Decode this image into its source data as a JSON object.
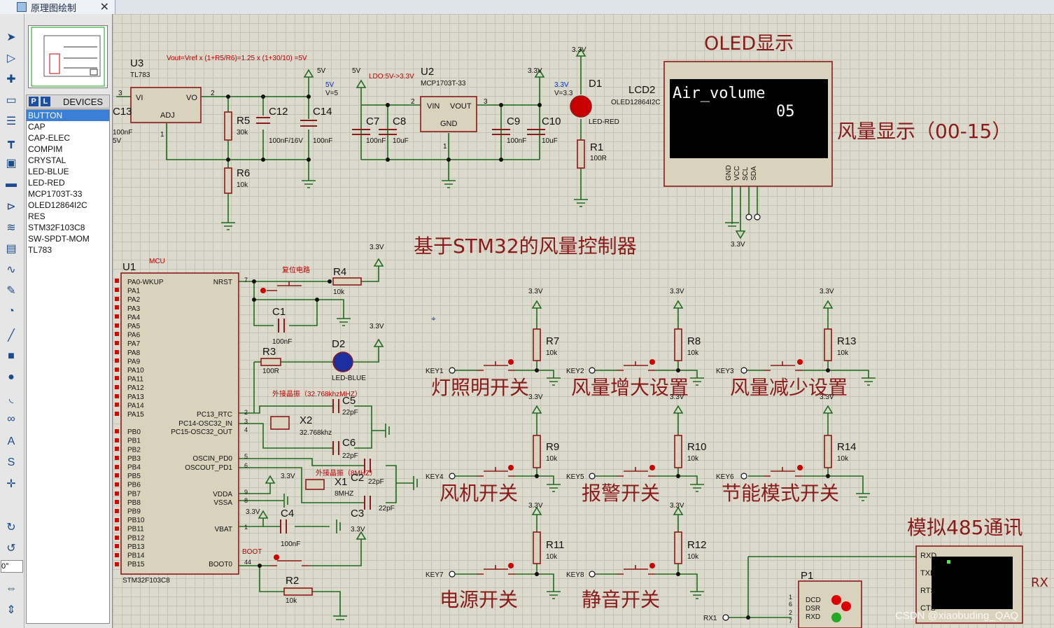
{
  "tab": {
    "title": "原理图绘制",
    "close": "✕"
  },
  "panel": {
    "p": "P",
    "l": "L",
    "header": "DEVICES",
    "rotation": "0°"
  },
  "devices": [
    "BUTTON",
    "CAP",
    "CAP-ELEC",
    "COMPIM",
    "CRYSTAL",
    "LED-BLUE",
    "LED-RED",
    "MCP1703T-33",
    "OLED12864I2C",
    "RES",
    "STM32F103C8",
    "SW-SPDT-MOM",
    "TL783"
  ],
  "title": "基于STM32的风量控制器",
  "oled": {
    "title": "OLED显示",
    "line1": "Air_volume",
    "line2": "05",
    "ref": "LCD2",
    "part": "OLED12864I2C",
    "caption": "风量显示（00-15）",
    "pins": [
      "GND",
      "VCC",
      "SCL",
      "SDA"
    ],
    "pinnums": [
      "1",
      "2",
      "3",
      "4"
    ],
    "v": "3.3V"
  },
  "u3": {
    "ref": "U3",
    "part": "TL783",
    "formula": "Vout=Vref x (1+R5/R6)=1.25 x (1+30/10) =5V",
    "vi": "VI",
    "vo": "VO",
    "adj": "ADJ",
    "p3": "3",
    "p2": "2",
    "p1": "1",
    "out": "5V",
    "probe": "5V",
    "probev": "V=5"
  },
  "u3parts": {
    "c13": "C13",
    "c13v": "100nF",
    "c13v2": "5V",
    "r5": "R5",
    "r5v": "30k",
    "r6": "R6",
    "r6v": "10k",
    "c12": "C12",
    "c12v": "100nF/16V",
    "c14": "C14",
    "c14v": "100nF"
  },
  "u2": {
    "ref": "U2",
    "part": "MCP1703T-33",
    "note": "LDO:5V->3.3V",
    "vin": "VIN",
    "vout": "VOUT",
    "gnd": "GND",
    "p2": "2",
    "p3": "3",
    "p1": "1",
    "in": "5V",
    "out": "3.3V",
    "probe": "3.3V",
    "probev": "V=3.3",
    "c7": "C7",
    "c8": "C8",
    "c9": "C9",
    "c10": "C10",
    "c7v": "100nF",
    "c8v": "10uF",
    "c9v": "100nF",
    "c10v": "10uF"
  },
  "d1": {
    "ref": "D1",
    "part": "LED-RED",
    "v": "3.3V",
    "r1": "R1",
    "r1v": "100R"
  },
  "mcu": {
    "tag": "MCU",
    "ref": "U1",
    "part": "STM32F103C8",
    "left": [
      "PA0-WKUP",
      "PA1",
      "PA2",
      "PA3",
      "PA4",
      "PA5",
      "PA6",
      "PA7",
      "PA8",
      "PA9",
      "PA10",
      "PA11",
      "PA12",
      "PA13",
      "PA14",
      "PA15",
      "PB0",
      "PB1",
      "PB2",
      "PB3",
      "PB4",
      "PB5",
      "PB6",
      "PB7",
      "PB8",
      "PB9",
      "PB10",
      "PB11",
      "PB12",
      "PB13",
      "PB14",
      "PB15"
    ],
    "right": [
      "NRST",
      "PC13_RTC",
      "PC14-OSC32_IN",
      "PC15-OSC32_OUT",
      "OSCIN_PD0",
      "OSCOUT_PD1",
      "VDDA",
      "VSSA",
      "VBAT",
      "BOOT0"
    ],
    "rnums": [
      "7",
      "2",
      "3",
      "4",
      "5",
      "6",
      "9",
      "8",
      "1",
      "44"
    ]
  },
  "reset": {
    "title": "复位电路",
    "r4": "R4",
    "r4v": "10k",
    "c1": "C1",
    "c1v": "100nF",
    "v": "3.3V"
  },
  "d2": {
    "ref": "D2",
    "part": "LED-BLUE",
    "r3": "R3",
    "r3v": "100R",
    "v": "3.3V"
  },
  "x2": {
    "title": "外接晶振（32.768khzMHZ）",
    "ref": "X2",
    "v": "32.768khz",
    "c5": "C5",
    "c5v": "22pF",
    "c6": "C6",
    "c6v": "22pF"
  },
  "x1": {
    "title": "外接晶振（8MHZ）",
    "ref": "X1",
    "v": "8MHZ",
    "c2": "C2",
    "c2v": "22pF",
    "c3": "C3",
    "c3v": "22pF",
    "v33": "3.3V"
  },
  "vbat": {
    "c4": "C4",
    "c4v": "100nF",
    "v": "3.3V",
    "c3v": "3.3V"
  },
  "boot": {
    "title": "BOOT",
    "r2": "R2",
    "r2v": "10k"
  },
  "keys": [
    {
      "key": "KEY1",
      "r": "R7",
      "rv": "10k",
      "label": "灯照明开关",
      "v": "3.3V"
    },
    {
      "key": "KEY2",
      "r": "R8",
      "rv": "10k",
      "label": "风量增大设置",
      "v": "3.3V"
    },
    {
      "key": "KEY3",
      "r": "R13",
      "rv": "10k",
      "label": "风量减少设置",
      "v": "3.3V"
    },
    {
      "key": "KEY4",
      "r": "R9",
      "rv": "10k",
      "label": "风机开关",
      "v": "3.3V"
    },
    {
      "key": "KEY5",
      "r": "R10",
      "rv": "10k",
      "label": "报警开关",
      "v": "3.3V"
    },
    {
      "key": "KEY6",
      "r": "R14",
      "rv": "10k",
      "label": "节能模式开关",
      "v": "3.3V"
    },
    {
      "key": "KEY7",
      "r": "R11",
      "rv": "10k",
      "label": "电源开关",
      "v": "3.3V"
    },
    {
      "key": "KEY8",
      "r": "R12",
      "rv": "10k",
      "label": "静音开关",
      "v": "3.3V"
    }
  ],
  "comm": {
    "title": "模拟485通讯",
    "pins": [
      "RXD",
      "TXD",
      "RTS",
      "CTS"
    ],
    "p1": "P1",
    "p1pins": [
      "DCD",
      "DSR",
      "RXD"
    ],
    "p1nums": [
      "1",
      "6",
      "2",
      "7"
    ],
    "rx1": "RX1",
    "rx": "RX"
  },
  "watermark": "CSDN @xiaobuding_QAQ"
}
